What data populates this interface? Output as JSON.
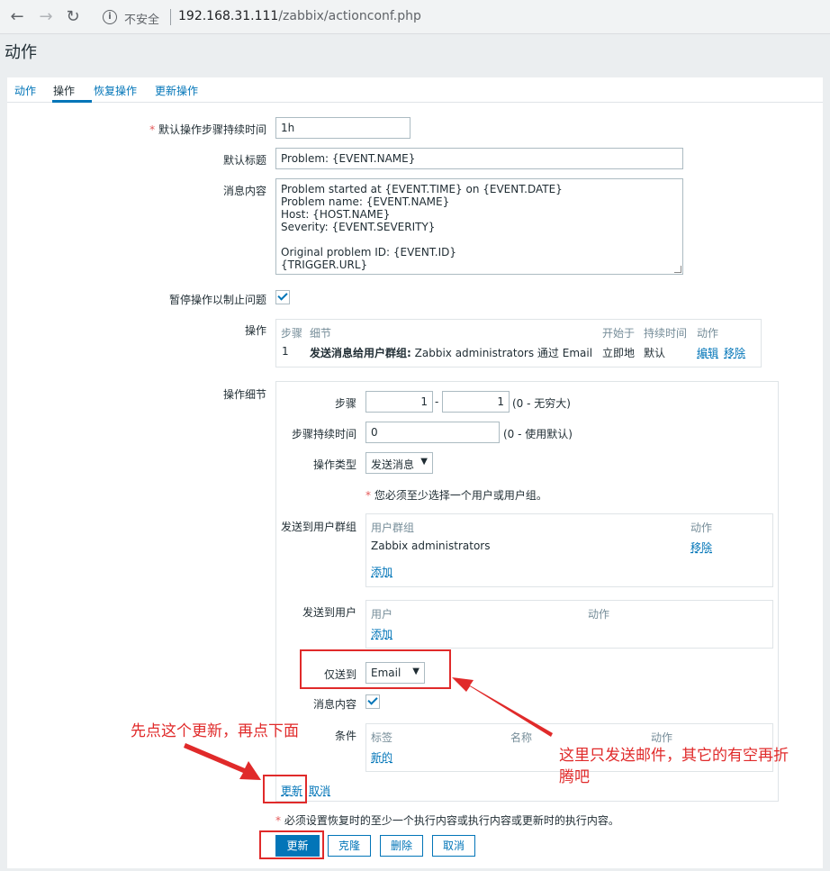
{
  "browser": {
    "insecure_label": "不安全",
    "url_host": "192.168.31.111",
    "url_path": "/zabbix/actionconf.php"
  },
  "page_title": "动作",
  "tabs": [
    {
      "label": "动作",
      "active": false
    },
    {
      "label": "操作",
      "active": true
    },
    {
      "label": "恢复操作",
      "active": false
    },
    {
      "label": "更新操作",
      "active": false
    }
  ],
  "form": {
    "default_step_duration": {
      "label": "默认操作步骤持续时间",
      "required": "*",
      "value": "1h"
    },
    "default_subject": {
      "label": "默认标题",
      "value": "Problem: {EVENT.NAME}"
    },
    "message": {
      "label": "消息内容",
      "value": "Problem started at {EVENT.TIME} on {EVENT.DATE}\nProblem name: {EVENT.NAME}\nHost: {HOST.NAME}\nSeverity: {EVENT.SEVERITY}\n\nOriginal problem ID: {EVENT.ID}\n{TRIGGER.URL}"
    },
    "pause_operations": {
      "label": "暂停操作以制止问题",
      "checked": true
    },
    "operations": {
      "label": "操作",
      "headers": [
        "步骤",
        "细节",
        "开始于",
        "持续时间",
        "动作"
      ],
      "rows": [
        {
          "step": "1",
          "details_bold": "发送消息给用户群组:",
          "details_rest": "Zabbix administrators 通过 Email",
          "start": "立即地",
          "duration": "默认",
          "edit": "编辑",
          "remove": "移除"
        }
      ]
    },
    "operation_details": {
      "label": "操作细节",
      "steps": {
        "label": "步骤",
        "from": "1",
        "dash": "-",
        "to": "1",
        "hint": "(0 - 无穷大)"
      },
      "step_duration": {
        "label": "步骤持续时间",
        "value": "0",
        "hint": "(0 - 使用默认)"
      },
      "operation_type": {
        "label": "操作类型",
        "value": "发送消息"
      },
      "warning": {
        "mark": "*",
        "text": "您必须至少选择一个用户或用户组。"
      },
      "user_groups": {
        "label": "发送到用户群组",
        "headers": [
          "用户群组",
          "动作"
        ],
        "rows": [
          {
            "name": "Zabbix administrators",
            "action": "移除"
          }
        ],
        "add": "添加"
      },
      "users": {
        "label": "发送到用户",
        "headers": [
          "用户",
          "动作"
        ],
        "add": "添加"
      },
      "send_only_to": {
        "label": "仅送到",
        "value": "Email"
      },
      "default_message": {
        "label": "消息内容",
        "checked": true
      },
      "conditions": {
        "label": "条件",
        "headers": [
          "标签",
          "名称",
          "动作"
        ],
        "add": "新的"
      },
      "update_link": "更新",
      "cancel_link": "取消"
    },
    "footer_warning": {
      "mark": "*",
      "text": "必须设置恢复时的至少一个执行内容或执行内容或更新时的执行内容。"
    },
    "buttons": {
      "update": "更新",
      "clone": "克隆",
      "delete": "删除",
      "cancel": "取消"
    }
  },
  "annotations": {
    "note_left": "先点这个更新，再点下面",
    "note_right_line1": "这里只发送邮件，其它的有空再折",
    "note_right_line2": "腾吧"
  },
  "colors": {
    "accent": "#0275b8",
    "annotation": "#e02a2a"
  }
}
